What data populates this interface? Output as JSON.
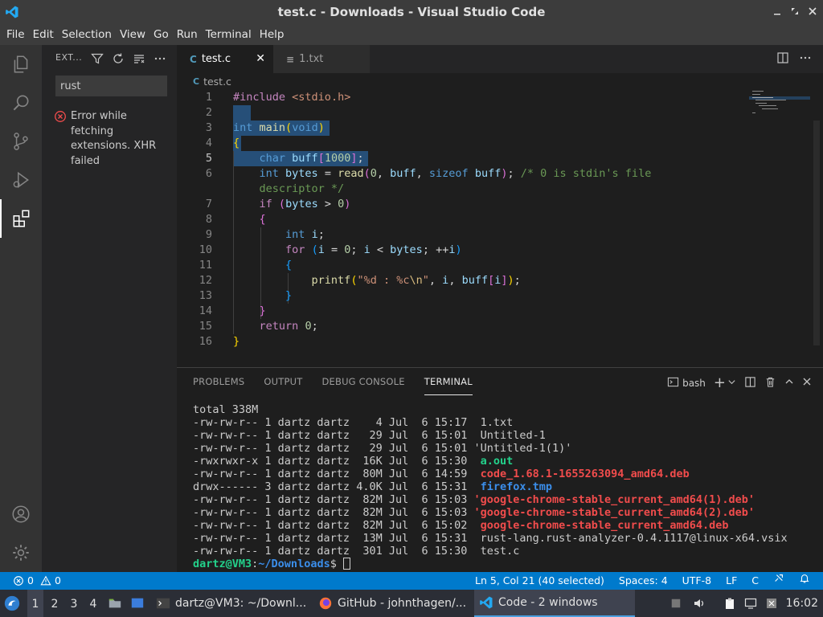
{
  "window": {
    "title": "test.c - Downloads - Visual Studio Code"
  },
  "menu": [
    "File",
    "Edit",
    "Selection",
    "View",
    "Go",
    "Run",
    "Terminal",
    "Help"
  ],
  "sidebar": {
    "header": "EXT...",
    "search_value": "rust",
    "error": "Error while fetching extensions. XHR failed"
  },
  "tabs": [
    {
      "label": "test.c",
      "icon": "C"
    },
    {
      "label": "1.txt",
      "icon": "≡"
    }
  ],
  "breadcrumb": {
    "icon": "C",
    "file": "test.c"
  },
  "editor": {
    "line_numbers": [
      "1",
      "2",
      "3",
      "4",
      "5",
      "6",
      "",
      "7",
      "8",
      "9",
      "10",
      "11",
      "12",
      "13",
      "14",
      "15",
      "16"
    ]
  },
  "panel": {
    "tabs": [
      "PROBLEMS",
      "OUTPUT",
      "DEBUG CONSOLE",
      "TERMINAL"
    ],
    "shell": "bash",
    "terminal": {
      "total": "total 338M",
      "rows": [
        {
          "meta": "-rw-rw-r-- 1 dartz dartz    4 Jul  6 15:17 ",
          "name": " 1.txt",
          "kind": "plain"
        },
        {
          "meta": "-rw-rw-r-- 1 dartz dartz   29 Jul  6 15:01 ",
          "name": " Untitled-1",
          "kind": "plain"
        },
        {
          "meta": "-rw-rw-r-- 1 dartz dartz   29 Jul  6 15:01 ",
          "name": "'Untitled-1(1)'",
          "kind": "plain"
        },
        {
          "meta": "-rwxrwxr-x 1 dartz dartz  16K Jul  6 15:30 ",
          "name": " a.out",
          "kind": "green"
        },
        {
          "meta": "-rw-rw-r-- 1 dartz dartz  80M Jul  6 14:59 ",
          "name": " code_1.68.1-1655263094_amd64.deb",
          "kind": "red"
        },
        {
          "meta": "drwx------ 3 dartz dartz 4.0K Jul  6 15:31 ",
          "name": " firefox.tmp",
          "kind": "blue"
        },
        {
          "meta": "-rw-rw-r-- 1 dartz dartz  82M Jul  6 15:03 ",
          "name": "'google-chrome-stable_current_amd64(1).deb'",
          "kind": "red"
        },
        {
          "meta": "-rw-rw-r-- 1 dartz dartz  82M Jul  6 15:03 ",
          "name": "'google-chrome-stable_current_amd64(2).deb'",
          "kind": "red"
        },
        {
          "meta": "-rw-rw-r-- 1 dartz dartz  82M Jul  6 15:02 ",
          "name": " google-chrome-stable_current_amd64.deb",
          "kind": "red"
        },
        {
          "meta": "-rw-rw-r-- 1 dartz dartz  13M Jul  6 15:31 ",
          "name": " rust-lang.rust-analyzer-0.4.1117@linux-x64.vsix",
          "kind": "plain"
        },
        {
          "meta": "-rw-rw-r-- 1 dartz dartz  301 Jul  6 15:30 ",
          "name": " test.c",
          "kind": "plain"
        }
      ],
      "prompt_user": "dartz@VM3",
      "prompt_sep": ":",
      "prompt_path": "~/Downloads",
      "prompt_end": "$ "
    }
  },
  "statusbar": {
    "errors": "0",
    "warnings": "0",
    "position": "Ln 5, Col 21 (40 selected)",
    "spaces": "Spaces: 4",
    "encoding": "UTF-8",
    "eol": "LF",
    "language": "C"
  },
  "taskbar": {
    "workspaces": [
      "1",
      "2",
      "3",
      "4"
    ],
    "windows": [
      {
        "label": "dartz@VM3: ~/Downl..."
      },
      {
        "label": "GitHub - johnthagen/..."
      },
      {
        "label": "Code - 2 windows"
      }
    ],
    "clock": "16:02"
  },
  "colors": {
    "accent": "#007acc",
    "titlebar": "#3c3c3c",
    "editor_bg": "#1e1e1e",
    "selection": "#264f78"
  }
}
